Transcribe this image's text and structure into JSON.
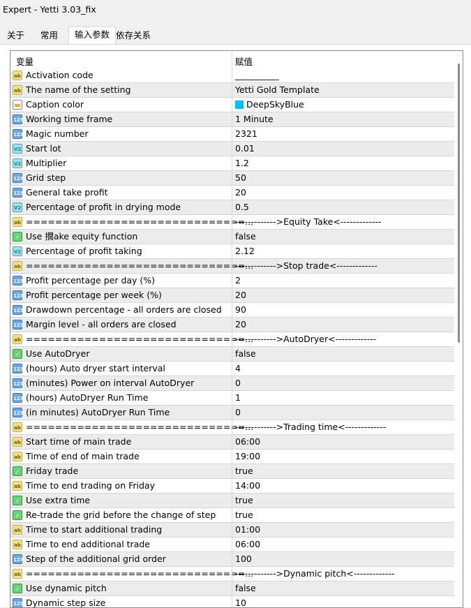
{
  "window": {
    "title": "Expert - Yetti 3.03_fix"
  },
  "tabs": [
    "关于",
    "常用",
    "输入参数",
    "依存关系"
  ],
  "active_tab": 2,
  "table": {
    "headers": {
      "variable": "变量",
      "value": "赋值"
    },
    "rows": [
      {
        "type": "ab",
        "name": "Activation code",
        "value": "__________"
      },
      {
        "type": "ab",
        "name": "The name of the setting",
        "value": "Yetti Gold Template"
      },
      {
        "type": "color",
        "name": "Caption color",
        "value": "DeepSkyBlue",
        "swatch": "#00bfff"
      },
      {
        "type": "n123",
        "name": "Working time frame",
        "value": "1 Minute"
      },
      {
        "type": "n123",
        "name": "Magic number",
        "value": "2321"
      },
      {
        "type": "v2",
        "name": "Start lot",
        "value": "0.01"
      },
      {
        "type": "v2",
        "name": "Multiplier",
        "value": "1.2"
      },
      {
        "type": "n123",
        "name": "Grid step",
        "value": "50"
      },
      {
        "type": "n123",
        "name": "General take profit",
        "value": "20"
      },
      {
        "type": "v2",
        "name": "Percentage of profit in drying mode",
        "value": "0.5"
      },
      {
        "type": "ab",
        "name": "==============================...",
        "value": "------------->Equity Take<-------------"
      },
      {
        "type": "bool",
        "name": "Use 撊ake equity function",
        "value": "false"
      },
      {
        "type": "v2",
        "name": "Percentage of profit taking",
        "value": "2.12"
      },
      {
        "type": "ab",
        "name": "==============================...",
        "value": "------------->Stop trade<-------------"
      },
      {
        "type": "n123",
        "name": "Profit percentage per day (%)",
        "value": "2"
      },
      {
        "type": "n123",
        "name": "Profit percentage per week (%)",
        "value": "20"
      },
      {
        "type": "n123",
        "name": "Drawdown percentage - all orders are closed",
        "value": "90"
      },
      {
        "type": "n123",
        "name": "Margin level - all orders are closed",
        "value": "20"
      },
      {
        "type": "ab",
        "name": "==============================...",
        "value": "------------->AutoDryer<-------------"
      },
      {
        "type": "bool",
        "name": "Use AutoDryer",
        "value": "false"
      },
      {
        "type": "n123",
        "name": "(hours) Auto dryer start interval",
        "value": "4"
      },
      {
        "type": "n123",
        "name": "(minutes) Power on interval AutoDryer",
        "value": "0"
      },
      {
        "type": "n123",
        "name": "(hours) AutoDryer Run Time",
        "value": "1"
      },
      {
        "type": "n123",
        "name": "(in minutes) AutoDryer Run Time",
        "value": "0"
      },
      {
        "type": "ab",
        "name": "==============================...",
        "value": "------------->Trading time<-------------"
      },
      {
        "type": "ab",
        "name": "Start time of main trade",
        "value": "06:00"
      },
      {
        "type": "ab",
        "name": "Time of end of main trade",
        "value": "19:00"
      },
      {
        "type": "bool",
        "name": "Friday trade",
        "value": "true"
      },
      {
        "type": "ab",
        "name": "Time to end trading on Friday",
        "value": "14:00"
      },
      {
        "type": "bool",
        "name": "Use extra time",
        "value": "true"
      },
      {
        "type": "bool",
        "name": "Re-trade the grid before the change of step",
        "value": "true"
      },
      {
        "type": "ab",
        "name": "Time to start additional trading",
        "value": "01:00"
      },
      {
        "type": "ab",
        "name": "Time to end additional trade",
        "value": "06:00"
      },
      {
        "type": "n123",
        "name": "Step of the additional grid order",
        "value": "100"
      },
      {
        "type": "ab",
        "name": "==============================...",
        "value": "------------->Dynamic pitch<-------------"
      },
      {
        "type": "bool",
        "name": "Use dynamic pitch",
        "value": "false"
      },
      {
        "type": "n123",
        "name": "Dynamic step size",
        "value": "10"
      }
    ]
  },
  "icon_labels": {
    "ab": "ab",
    "n123": "123",
    "v2": "V2",
    "bool": "⁄",
    "color": ""
  }
}
